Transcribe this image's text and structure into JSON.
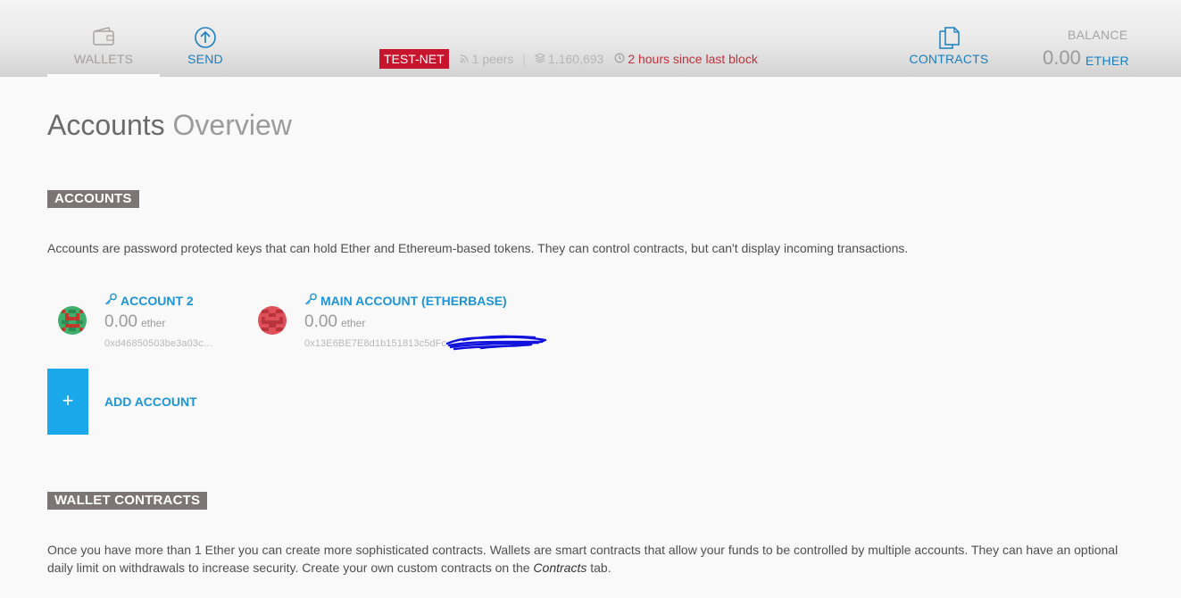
{
  "header": {
    "nav": {
      "wallets_label": "WALLETS",
      "send_label": "SEND",
      "contracts_label": "CONTRACTS"
    },
    "status": {
      "network_badge": "TEST-NET",
      "peers": "1 peers",
      "separator": "|",
      "block_number": "1,160,693",
      "last_block": "2 hours since last block"
    },
    "balance": {
      "label": "BALANCE",
      "amount": "0.00",
      "unit": "ETHER"
    }
  },
  "main": {
    "title_strong": "Accounts",
    "title_light": "Overview",
    "accounts_section": {
      "tag": "ACCOUNTS",
      "description": "Accounts are password protected keys that can hold Ether and Ethereum-based tokens. They can control contracts, but can't display incoming transactions.",
      "accounts": [
        {
          "name": "ACCOUNT 2",
          "amount": "0.00",
          "unit": "ether",
          "address": "0xd46850503be3a03c…"
        },
        {
          "name": "MAIN ACCOUNT (ETHERBASE)",
          "amount": "0.00",
          "unit": "ether",
          "address": "0x13E6BE7E8d1b151813c5dFc"
        }
      ],
      "add_button_symbol": "+",
      "add_label": "ADD ACCOUNT"
    },
    "wallet_contracts_section": {
      "tag": "WALLET CONTRACTS",
      "description_part1": "Once you have more than 1 Ether you can create more sophisticated contracts. Wallets are smart contracts that allow your funds to be controlled by multiple accounts. They can have an optional daily limit on withdrawals to increase security. Create your own custom contracts on the ",
      "description_link": "Contracts",
      "description_part2": " tab."
    }
  },
  "colors": {
    "accent_blue": "#1d94d6",
    "nav_blue": "#1a7fc0",
    "testnet_red": "#c6152d",
    "warning_red": "#c1323a",
    "tag_gray": "#7d7474",
    "add_button_blue": "#1ba8ea"
  },
  "icons": [
    "wallet-icon",
    "send-arrow-icon",
    "contracts-icon",
    "peers-icon",
    "blocks-icon",
    "clock-icon",
    "key-icon",
    "identicon"
  ]
}
